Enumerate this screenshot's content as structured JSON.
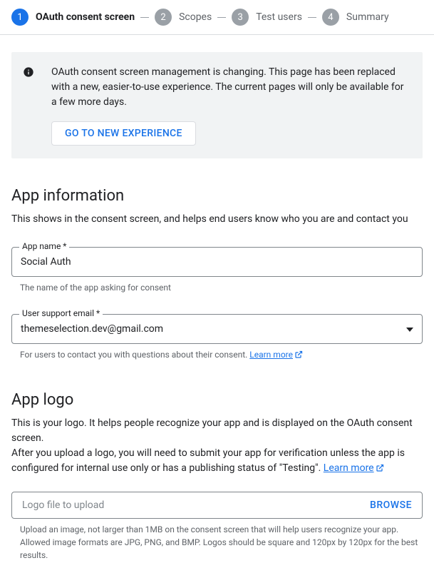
{
  "stepper": {
    "steps": [
      {
        "num": "1",
        "label": "OAuth consent screen"
      },
      {
        "num": "2",
        "label": "Scopes"
      },
      {
        "num": "3",
        "label": "Test users"
      },
      {
        "num": "4",
        "label": "Summary"
      }
    ]
  },
  "notice": {
    "text": "OAuth consent screen management is changing. This page has been replaced with a new, easier-to-use experience. The current pages will only be available for a few more days.",
    "action": "GO TO NEW EXPERIENCE"
  },
  "app_info": {
    "title": "App information",
    "desc": "This shows in the consent screen, and helps end users know who you are and contact you",
    "name_label": "App name *",
    "name_value": "Social Auth",
    "name_helper": "The name of the app asking for consent",
    "email_label": "User support email *",
    "email_value": "themeselection.dev@gmail.com",
    "email_helper": "For users to contact you with questions about their consent. ",
    "learn_more": "Learn more"
  },
  "app_logo": {
    "title": "App logo",
    "desc1": "This is your logo. It helps people recognize your app and is displayed on the OAuth consent screen.",
    "desc2_a": "After you upload a logo, you will need to submit your app for verification unless the app is configured for internal use only or has a publishing status of \"Testing\". ",
    "learn_more": "Learn more",
    "upload_placeholder": "Logo file to upload",
    "browse": "BROWSE",
    "upload_helper": "Upload an image, not larger than 1MB on the consent screen that will help users recognize your app. Allowed image formats are JPG, PNG, and BMP. Logos should be square and 120px by 120px for the best results."
  }
}
